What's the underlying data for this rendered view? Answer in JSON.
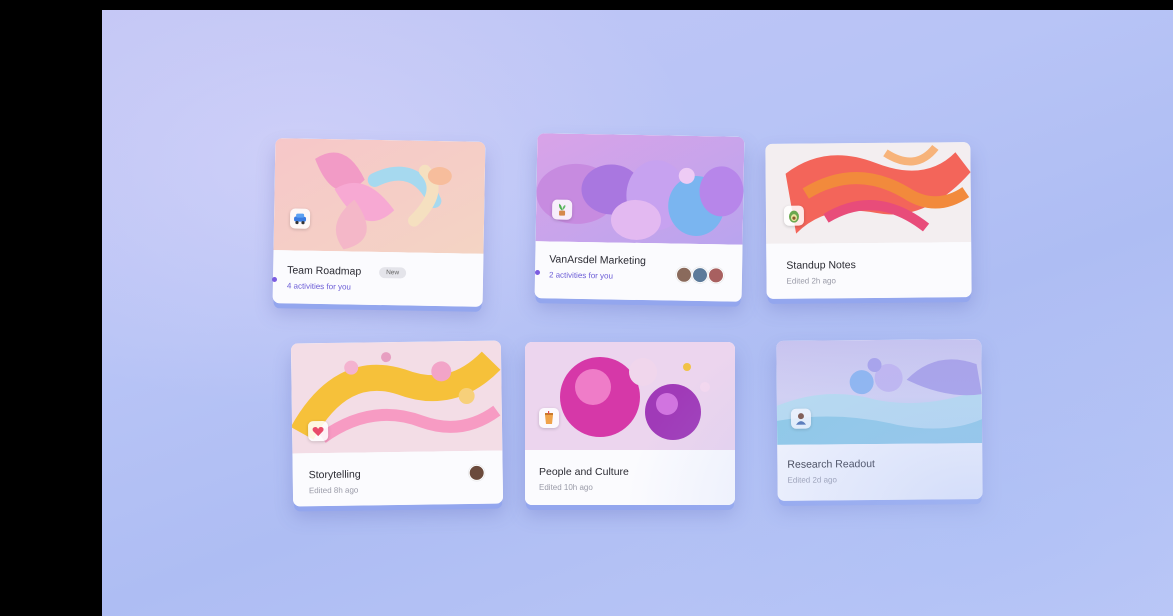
{
  "cards": [
    {
      "title": "Team Roadmap",
      "subtitle": "4 activities for you",
      "badge": "New",
      "icon": "car-icon"
    },
    {
      "title": "VanArsdel Marketing",
      "subtitle": "2 activities for you",
      "icon": "plant-icon"
    },
    {
      "title": "Standup Notes",
      "subtitle": "Edited 2h ago",
      "icon": "avocado-icon"
    },
    {
      "title": "Storytelling",
      "subtitle": "Edited 8h ago",
      "icon": "heart-icon"
    },
    {
      "title": "People and Culture",
      "subtitle": "Edited 10h ago",
      "icon": "cup-icon"
    },
    {
      "title": "Research Readout",
      "subtitle": "Edited 2d ago",
      "icon": "person-icon"
    }
  ]
}
